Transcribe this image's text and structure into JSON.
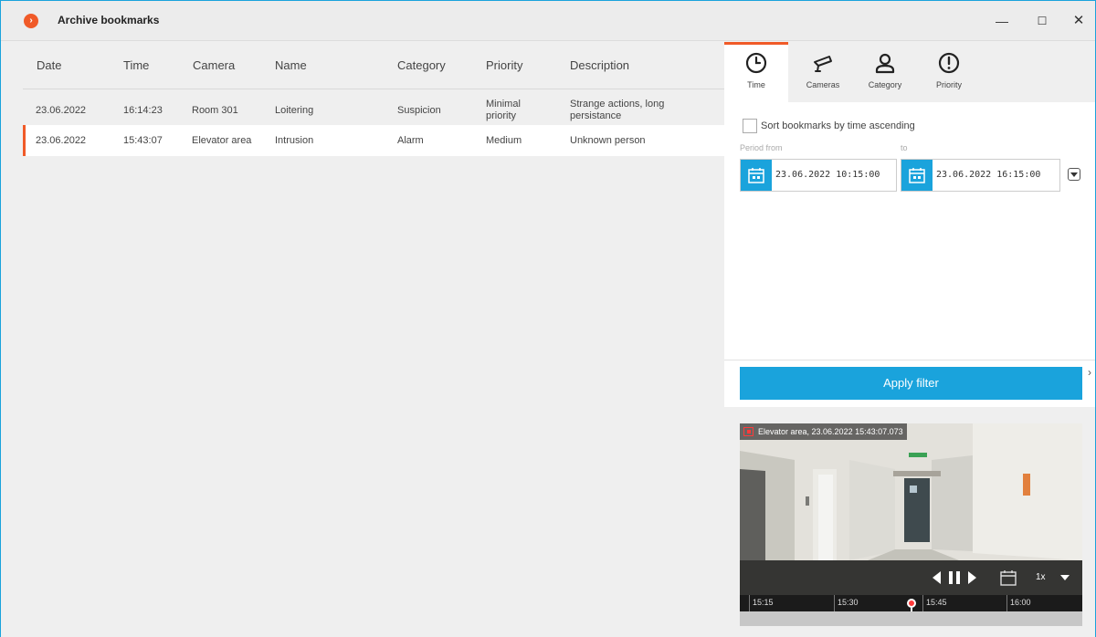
{
  "window": {
    "title": "Archive bookmarks",
    "logo_glyph": "›",
    "controls": {
      "minimize": "—",
      "maximize": "☐",
      "close": "✕"
    }
  },
  "table": {
    "columns": [
      "Date",
      "Time",
      "Camera",
      "Name",
      "Category",
      "Priority",
      "Description"
    ],
    "rows": [
      [
        "23.06.2022",
        "16:14:23",
        "Room 301",
        "Loitering",
        "Suspicion",
        "Minimal priority",
        "Strange actions, long persistance"
      ],
      [
        "23.06.2022",
        "15:43:07",
        "Elevator area",
        "Intrusion",
        "Alarm",
        "Medium",
        "Unknown person"
      ]
    ],
    "selected_row_index": 1
  },
  "tabs": [
    {
      "label": "Time",
      "icon": "clock-icon",
      "active": true
    },
    {
      "label": "Cameras",
      "icon": "camera-icon",
      "active": false
    },
    {
      "label": "Category",
      "icon": "person-icon",
      "active": false
    },
    {
      "label": "Priority",
      "icon": "exclamation-icon",
      "active": false
    }
  ],
  "filter": {
    "sort_label": "Sort bookmarks by time ascending",
    "sort_checked": false,
    "period_from_label": "Period from",
    "period_to_label": "to",
    "from_value": "23.06.2022  10:15:00",
    "to_value": "23.06.2022  16:15:00"
  },
  "apply_button": "Apply filter",
  "collapse_arrow": "›",
  "video": {
    "caption": "Elevator area, 23.06.2022 15:43:07.073",
    "speed": "1x",
    "timeline_labels": [
      "15:15",
      "15:30",
      "15:45",
      "16:00"
    ]
  },
  "colors": {
    "accent_blue": "#1aa3dc",
    "accent_orange": "#f05a28"
  }
}
